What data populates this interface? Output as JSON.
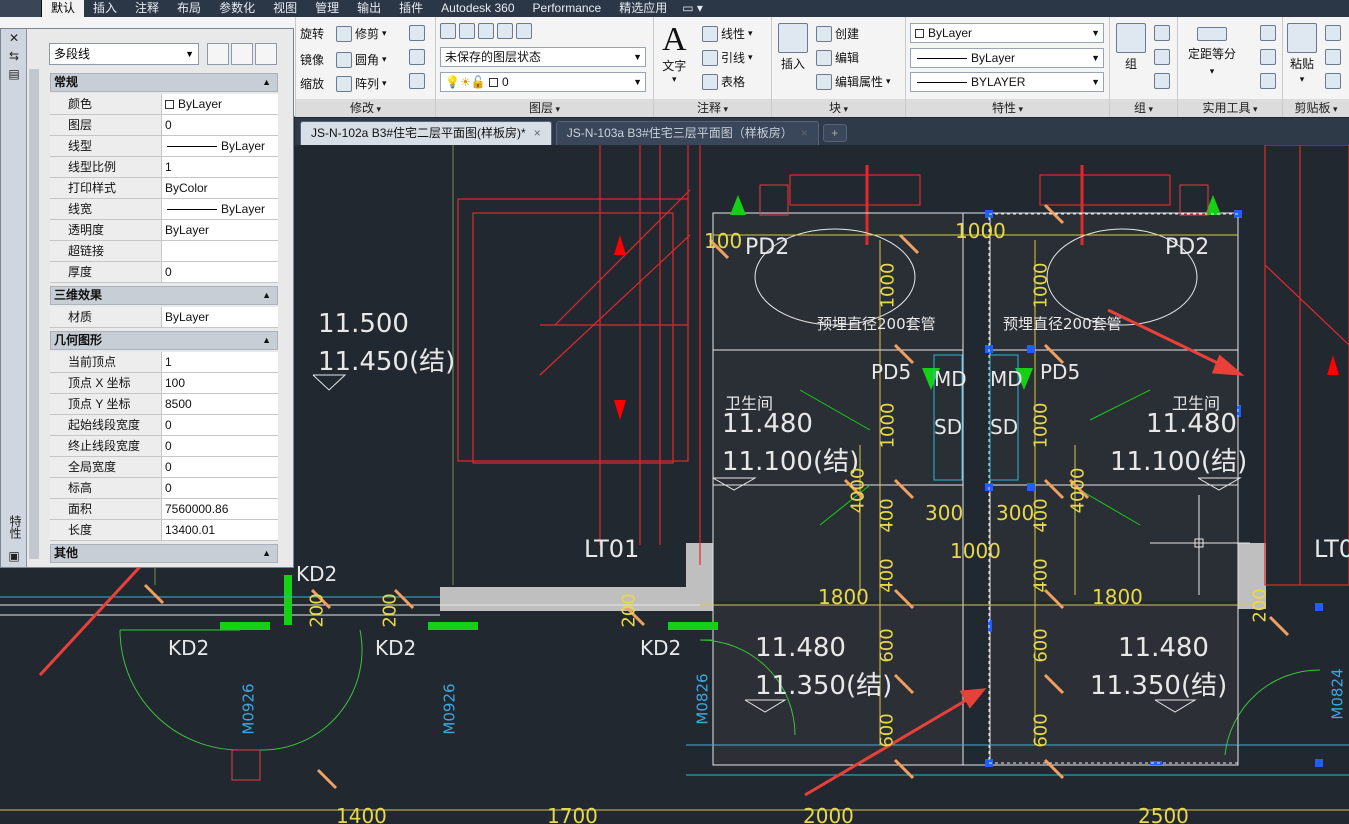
{
  "ribbon_tabs": [
    "默认",
    "插入",
    "注释",
    "布局",
    "参数化",
    "视图",
    "管理",
    "输出",
    "插件",
    "Autodesk 360",
    "Performance",
    "精选应用"
  ],
  "ribbon": {
    "modify": {
      "title": "修改",
      "items": [
        "旋转",
        "修剪",
        "镜像",
        "圆角",
        "缩放",
        "阵列"
      ]
    },
    "layers": {
      "title": "图层",
      "state": "未保存的图层状态",
      "current": "0"
    },
    "annotation": {
      "title": "注释",
      "text": "文字",
      "linear": "线性",
      "leader": "引线",
      "table": "表格"
    },
    "block": {
      "title": "块",
      "insert": "插入",
      "create": "创建",
      "edit": "编辑",
      "edit_attr": "编辑属性"
    },
    "properties": {
      "title": "特性",
      "color": "ByLayer",
      "linetype": "ByLayer",
      "lineweight": "BYLAYER"
    },
    "group": {
      "title": "组",
      "label": "组"
    },
    "utilities": {
      "title": "实用工具",
      "measure": "定距等分"
    },
    "clipboard": {
      "title": "剪贴板",
      "paste": "粘贴"
    }
  },
  "doc_tabs": [
    {
      "label": "JS-N-102a B3#住宅二层平面图(样板房)*",
      "close": "×"
    },
    {
      "label": "JS-N-103a B3#住宅三层平面图（样板房）",
      "close": "×"
    }
  ],
  "properties_panel": {
    "title": "特性",
    "object_type": "多段线",
    "sections": [
      {
        "name": "常规",
        "rows": [
          {
            "k": "颜色",
            "v": "ByLayer"
          },
          {
            "k": "图层",
            "v": "0"
          },
          {
            "k": "线型",
            "v": "ByLayer"
          },
          {
            "k": "线型比例",
            "v": "1"
          },
          {
            "k": "打印样式",
            "v": "ByColor"
          },
          {
            "k": "线宽",
            "v": "ByLayer"
          },
          {
            "k": "透明度",
            "v": "ByLayer"
          },
          {
            "k": "超链接",
            "v": ""
          },
          {
            "k": "厚度",
            "v": "0"
          }
        ]
      },
      {
        "name": "三维效果",
        "rows": [
          {
            "k": "材质",
            "v": "ByLayer"
          }
        ]
      },
      {
        "name": "几何图形",
        "rows": [
          {
            "k": "当前顶点",
            "v": "1"
          },
          {
            "k": "顶点 X 坐标",
            "v": "100"
          },
          {
            "k": "顶点 Y 坐标",
            "v": "8500"
          },
          {
            "k": "起始线段宽度",
            "v": "0"
          },
          {
            "k": "终止线段宽度",
            "v": "0"
          },
          {
            "k": "全局宽度",
            "v": "0"
          },
          {
            "k": "标高",
            "v": "0"
          },
          {
            "k": "面积",
            "v": "7560000.86"
          },
          {
            "k": "长度",
            "v": "13400.01"
          }
        ]
      },
      {
        "name": "其他",
        "rows": []
      }
    ]
  },
  "drawing": {
    "elev_left_1": "11.500",
    "elev_left_2": "11.450(结)",
    "pd2": "PD2",
    "pd5": "PD5",
    "md": "MD",
    "sd": "SD",
    "pipe_note": "预埋直径200套管",
    "bathroom": "卫生间",
    "elev_mid_1": "11.480",
    "elev_mid_2": "11.100(结)",
    "elev_low_1": "11.480",
    "elev_low_2": "11.350(结)",
    "lt01": "LT01",
    "kd2": "KD2",
    "m0926": "M0926",
    "m0826": "M0826",
    "m0824": "M0824",
    "dim_100": "100",
    "dim_1000": "1000",
    "dim_300": "300",
    "dim_1800": "1800",
    "dim_4000": "4000",
    "dim_400": "400",
    "dim_600": "600",
    "dim_200": "200",
    "dim_1400": "1400",
    "dim_1700": "1700",
    "dim_2000": "2000",
    "dim_2500": "2500"
  }
}
